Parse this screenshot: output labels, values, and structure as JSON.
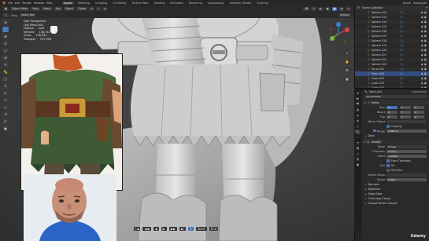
{
  "menubar": {
    "menus": [
      "File",
      "Edit",
      "Render",
      "Window",
      "Help"
    ],
    "workspaces": [
      "Layout",
      "Modeling",
      "Sculpting",
      "UV Editing",
      "Texture Paint",
      "Shading",
      "Animation",
      "Rendering",
      "Compositing",
      "Geometry Nodes",
      "Scripting"
    ],
    "active_workspace": "Layout",
    "scene_label": "Scene",
    "view_layer_label": "ViewLayer"
  },
  "viewport_header": {
    "mode": "Object Mode",
    "menus": [
      "View",
      "Select",
      "Add",
      "Object"
    ],
    "transform": "Global",
    "right_items": [
      "Options"
    ]
  },
  "tool_settings": {
    "items": [
      "Drag",
      "Select Box"
    ],
    "right_items": [
      "Options"
    ]
  },
  "viewport": {
    "view_name": "User Perspective",
    "collection": "(38) Mesh.004",
    "stats": [
      {
        "label": "Objects",
        "value": "1/45"
      },
      {
        "label": "Vertices",
        "value": "138,731"
      },
      {
        "label": "Faces",
        "value": "136,551"
      },
      {
        "label": "Triangles",
        "value": "272,990"
      }
    ]
  },
  "left_toolbar": {
    "tools": [
      "cursor",
      "select-box",
      "move",
      "rotate",
      "scale",
      "transform",
      "annotate",
      "measure",
      "add-cube",
      "brush",
      "draw",
      "knife",
      "shear",
      "spin",
      "bevel",
      "inset"
    ]
  },
  "timeline": {
    "playback_buttons": [
      "|◀",
      "◀◀",
      "◀",
      "▶",
      "▶▶",
      "▶|"
    ],
    "current_frame": "1",
    "start_label": "Start",
    "end_label": "End"
  },
  "outliner": {
    "header_label": "Scene Collection",
    "rows": [
      {
        "name": "Sphere.012",
        "mods": "▽◇",
        "selected": false
      },
      {
        "name": "Sphere.013",
        "mods": "▽◇",
        "selected": false
      },
      {
        "name": "Sphere.014",
        "mods": "▽◇",
        "selected": false
      },
      {
        "name": "Sphere.015",
        "mods": "▽◇",
        "selected": false
      },
      {
        "name": "Sphere.016",
        "mods": "▽◇",
        "selected": false
      },
      {
        "name": "Sphere.017",
        "mods": "▽◇",
        "selected": false
      },
      {
        "name": "Sphere.018",
        "mods": "▽◇",
        "selected": false
      },
      {
        "name": "Sphere.019",
        "mods": "▽◇",
        "selected": false
      },
      {
        "name": "Sphere.020",
        "mods": "▽◇",
        "selected": false
      },
      {
        "name": "Sphere.021",
        "mods": "▽◇",
        "selected": false
      },
      {
        "name": "Sphere.022",
        "mods": "▽◇",
        "selected": false
      },
      {
        "name": "Sphere.023",
        "mods": "▽◇",
        "selected": false
      },
      {
        "name": "Torus.001",
        "mods": "▽◇",
        "selected": false
      },
      {
        "name": "Mesh.004",
        "mods": "▽◇",
        "selected": true
      },
      {
        "name": "Cube.022",
        "mods": "▽◇",
        "selected": false
      },
      {
        "name": "Cube.023",
        "mods": "▽◇",
        "selected": false
      },
      {
        "name": "Cube.024",
        "mods": "▽◇",
        "selected": false
      }
    ]
  },
  "properties": {
    "object_name": "Mesh.004",
    "modifier_label": "Subdivision",
    "add_modifier": "Add Modifier",
    "mirror": {
      "name": "Mirror",
      "axis_label": "Axis",
      "bisect_label": "Bisect",
      "flip_label": "Flip",
      "axes": [
        "X",
        "Y",
        "Z"
      ],
      "mirror_object_label": "Mirror Object",
      "clipping_label": "Clipping",
      "merge_label": "Merge",
      "merge_value": "0.001 m"
    },
    "bevel_items": [
      "Data",
      "Bevel"
    ],
    "solidify": {
      "name": "Solidify",
      "mode_label": "Mode",
      "mode_value": "Simple",
      "thickness_label": "Thickness",
      "thickness_value": "0.02 m",
      "offset_label": "Offset",
      "offset_value": "-1.0000",
      "even_label": "Even Thickness",
      "rim_label": "Rim",
      "fill_label": "Fill",
      "only_rim_label": "Only Rim",
      "vertex_group_label": "Vertex Group",
      "factor_label": "Factor",
      "factor_value": "0.000"
    },
    "collapsed_sections": [
      "Normals",
      "Materials",
      "Edge Data",
      "Thickness Clamp",
      "Output Vertex Groups"
    ]
  },
  "watermark": "Udemy"
}
